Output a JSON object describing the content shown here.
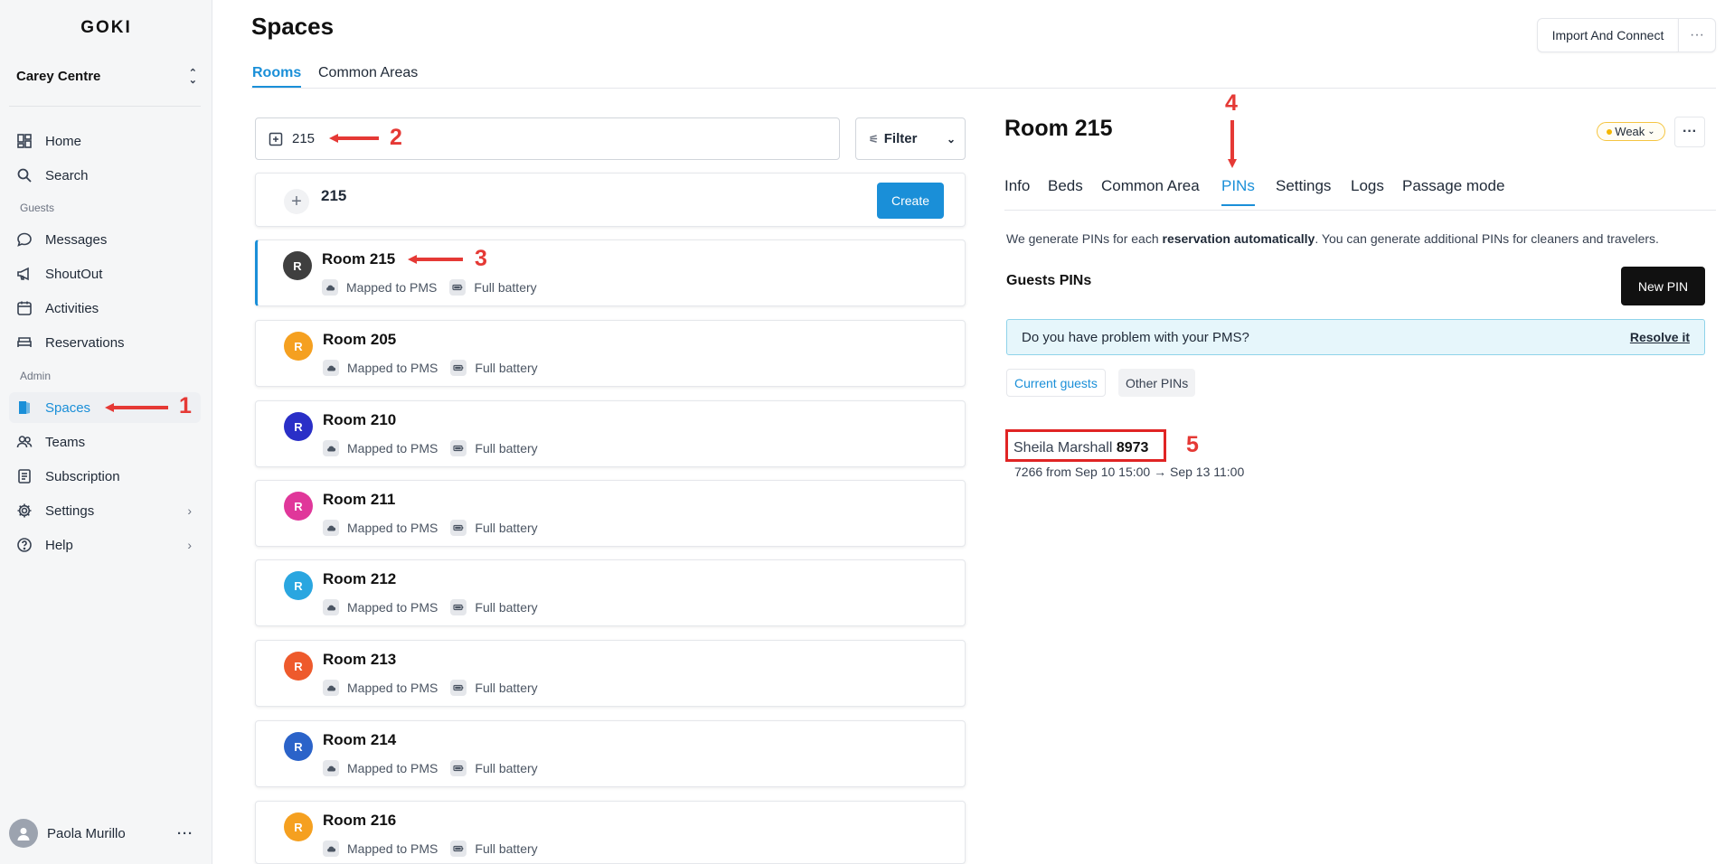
{
  "sidebar": {
    "logo": "GOKI",
    "property": "Carey Centre",
    "items_main": [
      {
        "label": "Home",
        "icon": "dashboard-icon"
      },
      {
        "label": "Search",
        "icon": "search-icon"
      }
    ],
    "section_guests": "Guests",
    "items_guests": [
      {
        "label": "Messages",
        "icon": "message-icon"
      },
      {
        "label": "ShoutOut",
        "icon": "megaphone-icon"
      },
      {
        "label": "Activities",
        "icon": "calendar-icon"
      },
      {
        "label": "Reservations",
        "icon": "bed-icon"
      }
    ],
    "section_admin": "Admin",
    "items_admin": [
      {
        "label": "Spaces",
        "icon": "door-icon",
        "active": true
      },
      {
        "label": "Teams",
        "icon": "users-icon"
      },
      {
        "label": "Subscription",
        "icon": "receipt-icon"
      },
      {
        "label": "Settings",
        "icon": "gear-icon"
      },
      {
        "label": "Help",
        "icon": "help-icon"
      }
    ],
    "user_name": "Paola Murillo"
  },
  "header": {
    "title": "Spaces",
    "import_label": "Import And Connect",
    "tabs": [
      "Rooms",
      "Common Areas"
    ]
  },
  "list": {
    "search_value": "215",
    "filter_label": "Filter",
    "create_name": "215",
    "create_label": "Create",
    "meta_pms": "Mapped to PMS",
    "meta_battery": "Full battery",
    "rooms": [
      {
        "name": "Room 215",
        "initial": "R",
        "color": "#3f3f3f"
      },
      {
        "name": "Room 205",
        "initial": "R",
        "color": "#f5a020"
      },
      {
        "name": "Room 210",
        "initial": "R",
        "color": "#2a2fc7"
      },
      {
        "name": "Room 211",
        "initial": "R",
        "color": "#e0379a"
      },
      {
        "name": "Room 212",
        "initial": "R",
        "color": "#2aa6e0"
      },
      {
        "name": "Room 213",
        "initial": "R",
        "color": "#ee5a2c"
      },
      {
        "name": "Room 214",
        "initial": "R",
        "color": "#2b63c9"
      },
      {
        "name": "Room 216",
        "initial": "R",
        "color": "#f5a020"
      }
    ]
  },
  "detail": {
    "title": "Room 215",
    "signal": "Weak",
    "tabs": [
      "Info",
      "Beds",
      "Common Area",
      "PINs",
      "Settings",
      "Logs",
      "Passage mode"
    ],
    "description_pre": "We generate PINs for each ",
    "description_bold": "reservation automatically",
    "description_post": ". You can generate additional PINs for cleaners and travelers.",
    "section_title": "Guests PINs",
    "new_pin_label": "New PIN",
    "banner_text": "Do you have problem with your PMS?",
    "banner_link": "Resolve it",
    "pin_tabs": [
      "Current guests",
      "Other PINs"
    ],
    "guest_name": "Sheila Marshall",
    "guest_pin": "8973",
    "guest_line": "7266 from Sep 10 15:00 → Sep 13 11:00"
  },
  "annotations": [
    "1",
    "2",
    "3",
    "4",
    "5"
  ],
  "colors": {
    "accent": "#1a8fd8",
    "annotation": "#e53935"
  }
}
